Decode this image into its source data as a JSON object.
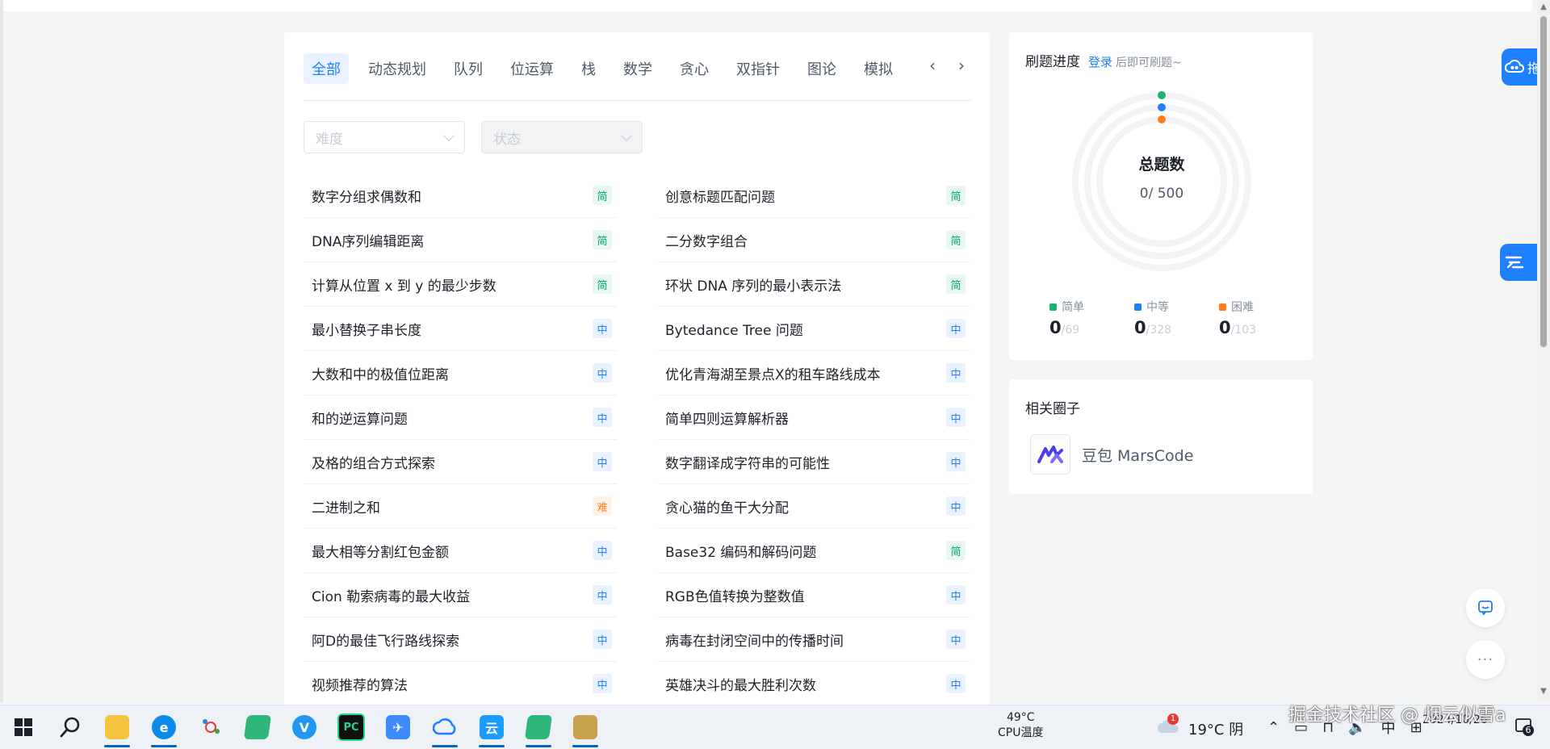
{
  "tabs": {
    "items": [
      "全部",
      "动态规划",
      "队列",
      "位运算",
      "栈",
      "数学",
      "贪心",
      "双指针",
      "图论",
      "模拟"
    ],
    "active": 0
  },
  "filters": {
    "difficulty_placeholder": "难度",
    "status_placeholder": "状态"
  },
  "difficulty_labels": {
    "easy": "简",
    "mid": "中",
    "hard": "难"
  },
  "problems": [
    {
      "title": "数字分组求偶数和",
      "level": "easy",
      "badge": "简"
    },
    {
      "title": "创意标题匹配问题",
      "level": "easy",
      "badge": "简"
    },
    {
      "title": "DNA序列编辑距离",
      "level": "easy",
      "badge": "简"
    },
    {
      "title": "二分数字组合",
      "level": "easy",
      "badge": "简"
    },
    {
      "title": "计算从位置 x 到 y 的最少步数",
      "level": "easy",
      "badge": "简"
    },
    {
      "title": "环状 DNA 序列的最小表示法",
      "level": "easy",
      "badge": "简"
    },
    {
      "title": "最小替换子串长度",
      "level": "mid",
      "badge": "中"
    },
    {
      "title": "Bytedance Tree 问题",
      "level": "mid",
      "badge": "中"
    },
    {
      "title": "大数和中的极值位距离",
      "level": "mid",
      "badge": "中"
    },
    {
      "title": "优化青海湖至景点X的租车路线成本",
      "level": "mid",
      "badge": "中"
    },
    {
      "title": "和的逆运算问题",
      "level": "mid",
      "badge": "中"
    },
    {
      "title": "简单四则运算解析器",
      "level": "mid",
      "badge": "中"
    },
    {
      "title": "及格的组合方式探索",
      "level": "mid",
      "badge": "中"
    },
    {
      "title": "数字翻译成字符串的可能性",
      "level": "mid",
      "badge": "中"
    },
    {
      "title": "二进制之和",
      "level": "hard",
      "badge": "难"
    },
    {
      "title": "贪心猫的鱼干大分配",
      "level": "mid",
      "badge": "中"
    },
    {
      "title": "最大相等分割红包金额",
      "level": "mid",
      "badge": "中"
    },
    {
      "title": "Base32 编码和解码问题",
      "level": "easy",
      "badge": "简"
    },
    {
      "title": "Cion 勒索病毒的最大收益",
      "level": "mid",
      "badge": "中"
    },
    {
      "title": "RGB色值转换为整数值",
      "level": "mid",
      "badge": "中"
    },
    {
      "title": "阿D的最佳飞行路线探索",
      "level": "mid",
      "badge": "中"
    },
    {
      "title": "病毒在封闭空间中的传播时间",
      "level": "mid",
      "badge": "中"
    },
    {
      "title": "视频推荐的算法",
      "level": "mid",
      "badge": "中"
    },
    {
      "title": "英雄决斗的最大胜利次数",
      "level": "mid",
      "badge": "中"
    }
  ],
  "progress": {
    "title": "刷题进度",
    "login_link": "登录",
    "login_tip": "后即可刷题~",
    "total_label": "总题数",
    "total_count": "0/ 500",
    "stats": [
      {
        "label": "简单",
        "value": "0",
        "total": "/69",
        "color": "#1bb16f"
      },
      {
        "label": "中等",
        "value": "0",
        "total": "/328",
        "color": "#1e80ff"
      },
      {
        "label": "困难",
        "value": "0",
        "total": "/103",
        "color": "#ff7d1a"
      }
    ],
    "ring_track_color": "#f2f3f5"
  },
  "circles": {
    "title": "相关圈子",
    "items": [
      {
        "name": "豆包 MarsCode"
      }
    ]
  },
  "float_tabs": [
    {
      "label": "拖"
    }
  ],
  "taskbar": {
    "cpu_temp": "49°C",
    "cpu_label": "CPU温度",
    "weather": "19°C 阴",
    "weather_badge": "1",
    "ime": "中",
    "time": "",
    "date": "2024/10/26",
    "notify_count": "6"
  },
  "watermark": "掘金技术社区 @ 烟云似雪a"
}
